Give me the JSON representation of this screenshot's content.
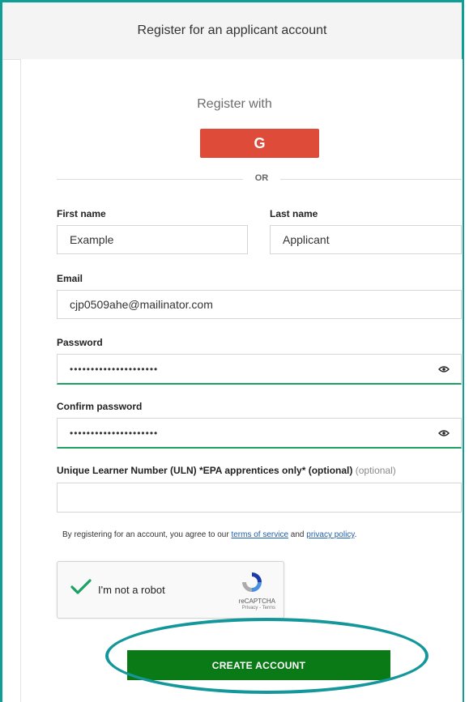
{
  "header": {
    "title": "Register for an applicant account"
  },
  "social": {
    "register_with": "Register with",
    "google_label": "G",
    "or": "OR"
  },
  "form": {
    "first_name": {
      "label": "First name",
      "value": "Example"
    },
    "last_name": {
      "label": "Last name",
      "value": "Applicant"
    },
    "email": {
      "label": "Email",
      "value": "cjp0509ahe@mailinator.com"
    },
    "password": {
      "label": "Password",
      "masked": "•••••••••••••••••••••"
    },
    "confirm_password": {
      "label": "Confirm password",
      "masked": "•••••••••••••••••••••"
    },
    "uln": {
      "label": "Unique Learner Number (ULN) *EPA apprentices only* (optional)",
      "optional_tag": "(optional)",
      "value": ""
    }
  },
  "terms": {
    "prefix": "By registering for an account, you agree to our ",
    "tos": "terms of service",
    "and": " and ",
    "privacy": "privacy policy",
    "suffix": "."
  },
  "captcha": {
    "label": "I'm not a robot",
    "brand": "reCAPTCHA",
    "links": "Privacy - Terms"
  },
  "submit": {
    "label": "CREATE ACCOUNT"
  },
  "colors": {
    "accent": "#0f9e95",
    "google": "#de4b39",
    "submit": "#0a7a17",
    "valid": "#1aa260"
  }
}
